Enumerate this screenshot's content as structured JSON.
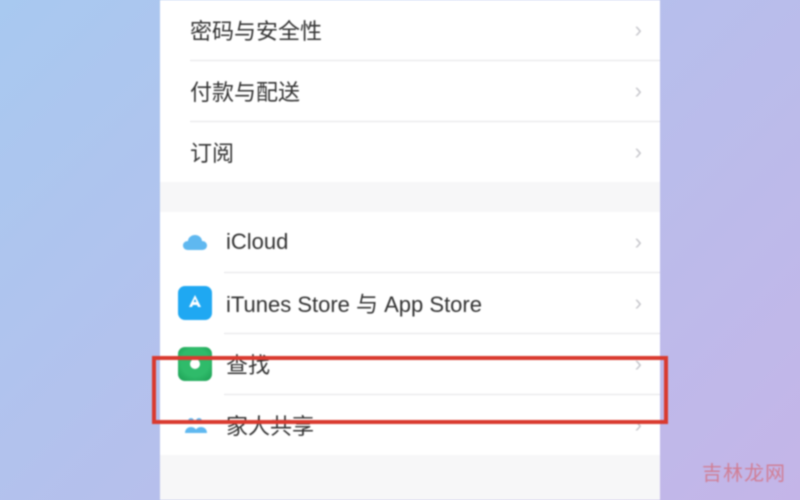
{
  "group1": {
    "items": [
      {
        "label": "密码与安全性"
      },
      {
        "label": "付款与配送"
      },
      {
        "label": "订阅"
      }
    ]
  },
  "group2": {
    "items": [
      {
        "label": "iCloud",
        "icon": "icloud"
      },
      {
        "label": "iTunes Store 与 App Store",
        "icon": "appstore"
      },
      {
        "label": "查找",
        "icon": "find"
      },
      {
        "label": "家人共享",
        "icon": "family"
      }
    ]
  },
  "chevron": "›",
  "watermark": "吉林龙网"
}
